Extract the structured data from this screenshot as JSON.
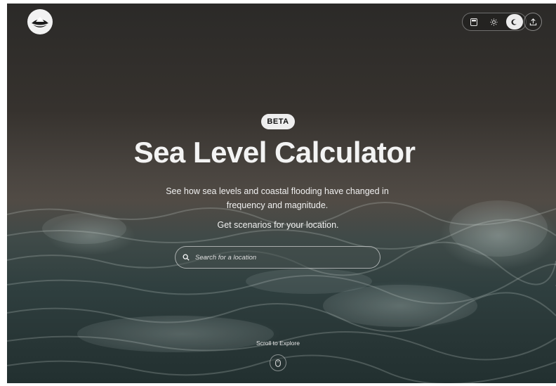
{
  "header": {
    "logo": {
      "icon": "noaa-logo",
      "text": "noaa"
    },
    "toolbar": [
      {
        "icon": "calculator-icon",
        "active": false
      },
      {
        "icon": "sun-icon",
        "active": false
      },
      {
        "icon": "moon-icon",
        "active": true
      }
    ],
    "share": {
      "icon": "share-upload-icon"
    }
  },
  "hero": {
    "badge": "BETA",
    "title": "Sea Level Calculator",
    "subtitle": "See how sea levels and coastal flooding have changed in frequency and magnitude.",
    "cta": "Get scenarios for your location.",
    "search": {
      "placeholder": "Search for a location",
      "value": "",
      "icon": "search-icon"
    },
    "scroll_label": "Scroll to Explore",
    "scroll_icon": "mouse-icon"
  }
}
